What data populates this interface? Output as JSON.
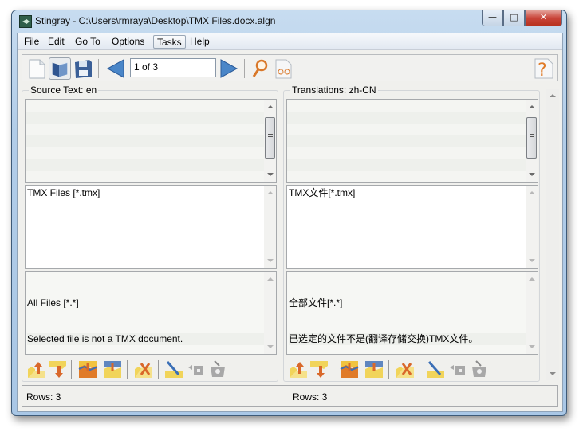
{
  "window": {
    "title": "Stingray - C:\\Users\\rmraya\\Desktop\\TMX Files.docx.algn",
    "controls": {
      "minimize": "—",
      "maximize": "□",
      "close": "✕"
    }
  },
  "menubar": {
    "items": [
      {
        "label": "File"
      },
      {
        "label": "Edit"
      },
      {
        "label": "Go To"
      },
      {
        "label": "Options"
      },
      {
        "label": "Tasks",
        "active": true
      },
      {
        "label": "Help"
      }
    ]
  },
  "toolbar": {
    "buttons": [
      "new-document",
      "open-folder",
      "save",
      "previous",
      "next",
      "find",
      "preview",
      "help"
    ],
    "pager_value": "1 of 3"
  },
  "source": {
    "label": "Source Text: en",
    "rows": [
      "",
      "TMX Files [*.tmx]",
      "All Files [*.*]\nSelected file is not a TMX document."
    ],
    "row3_line1": "All Files [*.*]",
    "row3_line2": "Selected file is not a TMX document.",
    "status": "Rows: 3"
  },
  "target": {
    "label": "Translations: zh-CN",
    "rows": [
      "",
      "TMX文件[*.tmx]",
      "全部文件[*.*]\n已选定的文件不是(翻译存储交换)TMX文件。"
    ],
    "row3_line1": "全部文件[*.*]",
    "row3_line2": "已选定的文件不是(翻译存储交换)TMX文件。",
    "status": "Rows: 3"
  },
  "segment_tools": [
    "move-up",
    "move-down",
    "merge-next",
    "split",
    "delete",
    "edit",
    "copy",
    "remove-tags"
  ],
  "colors": {
    "accent": "#3b6fb6",
    "toolbar_icon_orange": "#d9782a",
    "folder_yellow": "#f1d45a"
  }
}
